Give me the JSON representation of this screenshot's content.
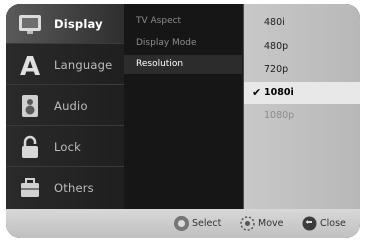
{
  "sidebar": {
    "items": [
      {
        "label": "Display",
        "icon": "display-icon"
      },
      {
        "label": "Language",
        "icon": "language-icon"
      },
      {
        "label": "Audio",
        "icon": "audio-icon"
      },
      {
        "label": "Lock",
        "icon": "lock-icon"
      },
      {
        "label": "Others",
        "icon": "others-icon"
      }
    ]
  },
  "settings": {
    "items": [
      {
        "label": "TV Aspect"
      },
      {
        "label": "Display Mode"
      },
      {
        "label": "Resolution"
      }
    ]
  },
  "resolution_options": {
    "items": [
      {
        "label": "480i"
      },
      {
        "label": "480p"
      },
      {
        "label": "720p"
      },
      {
        "label": "1080i"
      },
      {
        "label": "1080p"
      }
    ]
  },
  "help": {
    "select": "Select",
    "move": "Move",
    "close": "Close"
  }
}
